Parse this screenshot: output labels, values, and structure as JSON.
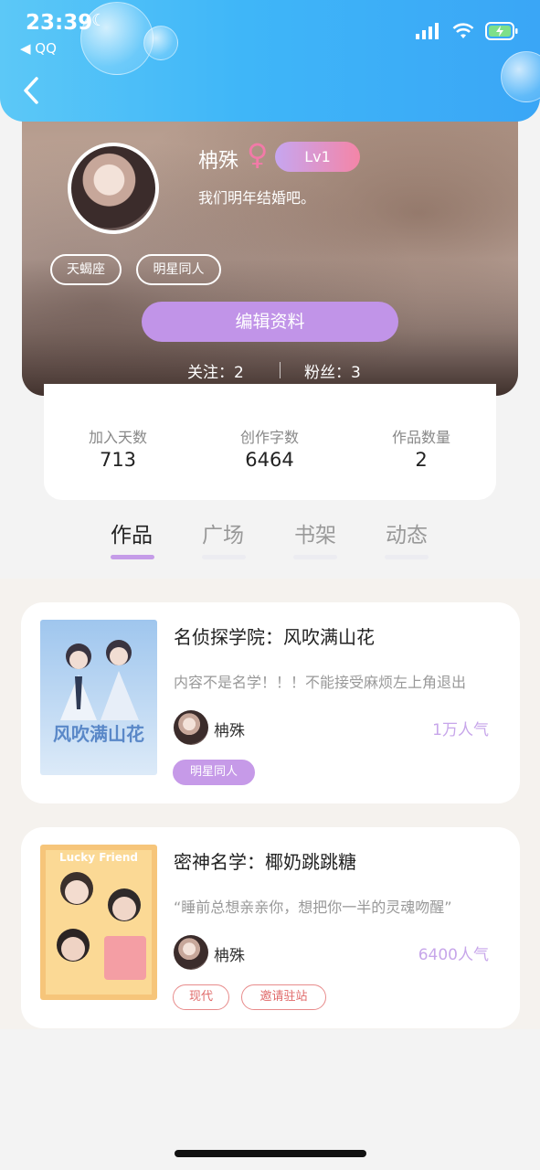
{
  "status": {
    "time": "23:39",
    "back_app": "◀ QQ"
  },
  "profile": {
    "name": "柟殊",
    "gender_symbol": "♀",
    "level": "Lv1",
    "bio": "我们明年结婚吧。",
    "tags": [
      "天蝎座",
      "明星同人"
    ],
    "edit_label": "编辑资料",
    "following_label": "关注：2",
    "followers_label": "粉丝：3"
  },
  "stats": [
    {
      "label": "加入天数",
      "value": "713"
    },
    {
      "label": "创作字数",
      "value": "6464"
    },
    {
      "label": "作品数量",
      "value": "2"
    }
  ],
  "tabs": [
    "作品",
    "广场",
    "书架",
    "动态"
  ],
  "works": [
    {
      "title": "名侦探学院：风吹满山花",
      "desc": "内容不是名学！！！不能接受麻烦左上角退出",
      "author": "柟殊",
      "popularity": "1万人气",
      "tags": [
        "明星同人"
      ],
      "cover_text": "风吹满山花"
    },
    {
      "title": "密神名学：椰奶跳跳糖",
      "desc": "“睡前总想亲亲你，想把你一半的灵魂吻醒”",
      "author": "柟殊",
      "popularity": "6400人气",
      "tags": [
        "现代",
        "邀请驻站"
      ],
      "cover_text": "Lucky Friend"
    }
  ],
  "colors": {
    "header_blue": "#3fb6f8",
    "accent_purple": "#c194e8",
    "tag_red": "#e06a6a"
  }
}
